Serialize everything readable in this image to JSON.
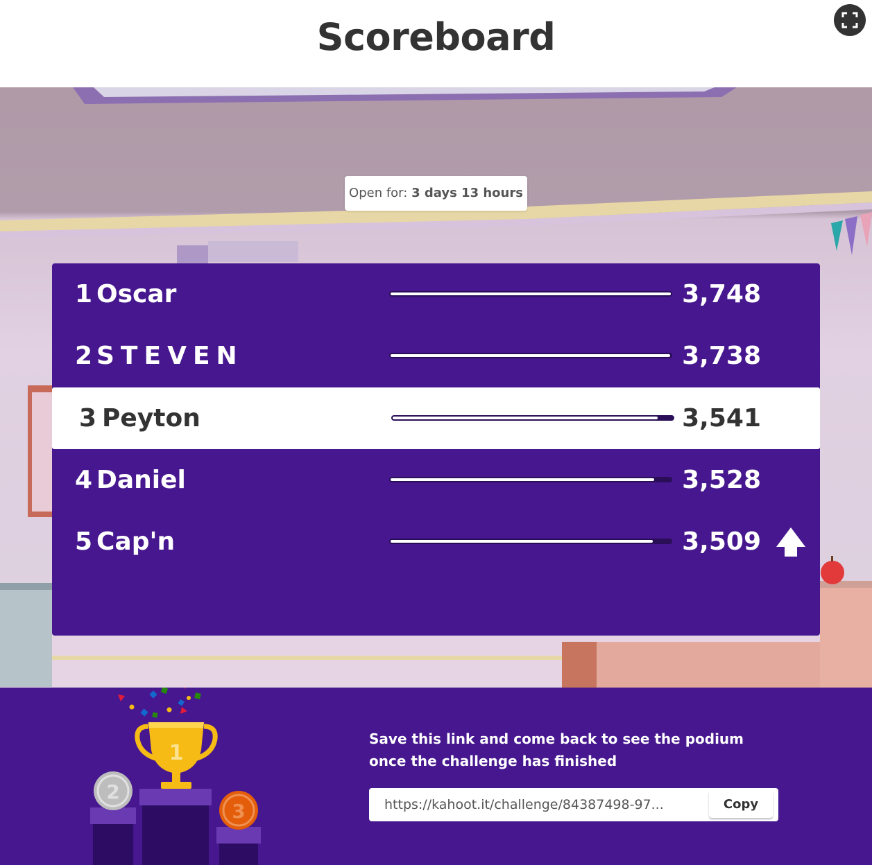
{
  "header": {
    "title": "Scoreboard"
  },
  "timer": {
    "prefix": "Open for:",
    "value": "3 days 13 hours"
  },
  "scoreboard": {
    "rows": [
      {
        "rank": "1",
        "name": "Oscar",
        "score": "3,748",
        "fraction": 1.0
      },
      {
        "rank": "2",
        "name": "STEVEN",
        "score": "3,738",
        "fraction": 0.997
      },
      {
        "rank": "3",
        "name": "Peyton",
        "score": "3,541",
        "fraction": 0.945,
        "highlighted": true
      },
      {
        "rank": "4",
        "name": "Daniel",
        "score": "3,528",
        "fraction": 0.941
      },
      {
        "rank": "5",
        "name": "Cap'n",
        "score": "3,509",
        "fraction": 0.936,
        "rank_change": "up-arrow-icon"
      }
    ]
  },
  "footer": {
    "message": "Save this link and come back to see the podium once the challenge has finished",
    "link_value": "https://kahoot.it/challenge/84387498-97...",
    "copy_label": "Copy"
  },
  "podium": {
    "first_label": "1",
    "second_label": "2",
    "third_label": "3"
  },
  "colors": {
    "brand_purple": "#46178f",
    "gold": "#f6bb14",
    "silver": "#bdbdbd",
    "bronze": "#e35d0b"
  }
}
